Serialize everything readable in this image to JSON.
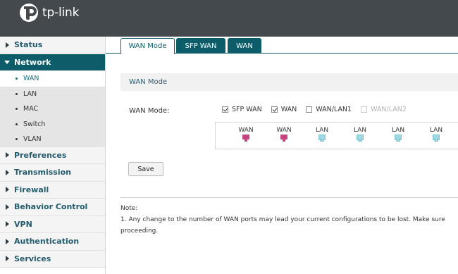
{
  "header": {
    "brand": "tp-link"
  },
  "sidebar": {
    "items": [
      {
        "label": "Status"
      },
      {
        "label": "Network"
      },
      {
        "label": "Preferences"
      },
      {
        "label": "Transmission"
      },
      {
        "label": "Firewall"
      },
      {
        "label": "Behavior Control"
      },
      {
        "label": "VPN"
      },
      {
        "label": "Authentication"
      },
      {
        "label": "Services"
      }
    ],
    "network_sub": [
      {
        "label": "WAN"
      },
      {
        "label": "LAN"
      },
      {
        "label": "MAC"
      },
      {
        "label": "Switch"
      },
      {
        "label": "VLAN"
      }
    ]
  },
  "tabs": [
    {
      "label": "WAN Mode"
    },
    {
      "label": "SFP WAN"
    },
    {
      "label": "WAN"
    }
  ],
  "section": {
    "title": "WAN Mode"
  },
  "wan_mode": {
    "label": "WAN Mode:",
    "options": [
      {
        "label": "SFP WAN",
        "checked": true
      },
      {
        "label": "WAN",
        "checked": true
      },
      {
        "label": "WAN/LAN1",
        "checked": false
      },
      {
        "label": "WAN/LAN2",
        "checked": false,
        "disabled": true
      }
    ],
    "ports": [
      {
        "label": "WAN",
        "color": "#c2457e"
      },
      {
        "label": "WAN",
        "color": "#c2457e"
      },
      {
        "label": "LAN",
        "color": "#5ab3c0"
      },
      {
        "label": "LAN",
        "color": "#5ab3c0"
      },
      {
        "label": "LAN",
        "color": "#5ab3c0"
      },
      {
        "label": "LAN",
        "color": "#5ab3c0"
      }
    ]
  },
  "save_label": "Save",
  "note": {
    "title": "Note:",
    "line1": "1. Any change to the number of WAN ports may lead your current configurations to be lost. Make sure",
    "line2": "proceeding."
  },
  "colors": {
    "header": "#43494d",
    "accent": "#0d5c6a",
    "wan_port": "#c2457e",
    "lan_port": "#5ab3c0"
  }
}
